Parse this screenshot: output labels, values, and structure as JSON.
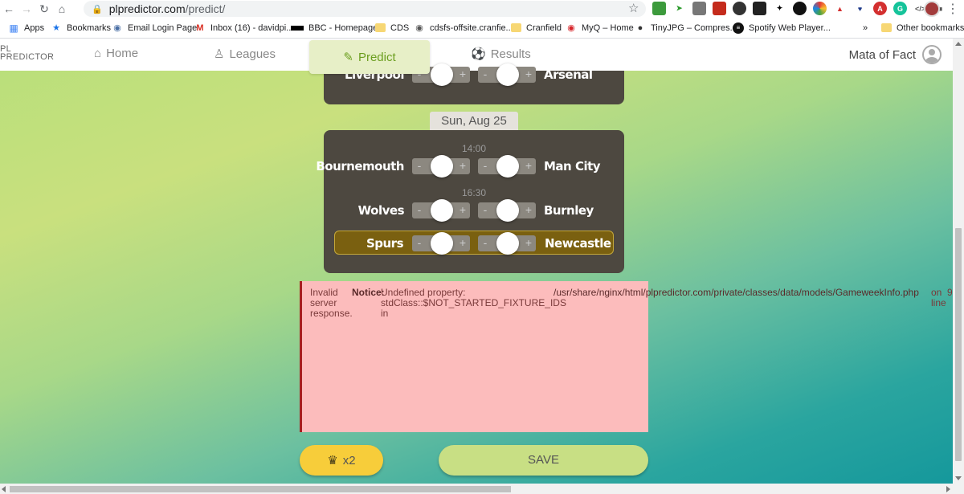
{
  "browser": {
    "url_host": "plpredictor.com",
    "url_path": "/predict/",
    "bookmarks": [
      {
        "label": "Apps",
        "icon": "apps-grid-icon"
      },
      {
        "label": "Bookmarks",
        "icon": "star-icon"
      },
      {
        "label": "Email Login Page",
        "icon": "globe-icon"
      },
      {
        "label": "Inbox (16) - davidpi...",
        "icon": "gmail-icon"
      },
      {
        "label": "BBC - Homepage",
        "icon": "bbc-icon"
      },
      {
        "label": "CDS",
        "icon": "folder-icon"
      },
      {
        "label": "cdsfs-offsite.cranfie...",
        "icon": "globe-icon"
      },
      {
        "label": "Cranfield",
        "icon": "folder-icon"
      },
      {
        "label": "MyQ – Home",
        "icon": "myq-icon"
      },
      {
        "label": "TinyJPG – Compres...",
        "icon": "panda-icon"
      },
      {
        "label": "Spotify Web Player...",
        "icon": "spotify-icon"
      }
    ],
    "more_bookmarks": "»",
    "other_bookmarks": "Other bookmarks"
  },
  "nav": {
    "logo_line1": "PL",
    "logo_line2": "PREDICTOR",
    "home": "Home",
    "leagues": "Leagues",
    "predict": "Predict",
    "results": "Results",
    "username": "Mata of Fact"
  },
  "previous_fixture": {
    "home": "Liverpool",
    "away": "Arsenal"
  },
  "date_label": "Sun, Aug 25",
  "time_slots": [
    "14:00",
    "16:30"
  ],
  "fixtures": [
    {
      "home": "Bournemouth",
      "away": "Man City"
    },
    {
      "home": "Wolves",
      "away": "Burnley"
    },
    {
      "home": "Spurs",
      "away": "Newcastle"
    }
  ],
  "stepper": {
    "minus": "-",
    "plus": "+"
  },
  "error": {
    "col1": "Invalid server response.",
    "col2": "Notice:",
    "col3": "Undefined property: stdClass::$NOT_STARTED_FIXTURE_IDS in",
    "col4": "/usr/share/nginx/html/plpredictor.com/private/classes/data/models/GameweekInfo.php",
    "col5": "on line",
    "col6": "9"
  },
  "buttons": {
    "double": "x2",
    "save": "SAVE"
  },
  "colors": {
    "accent": "#6b9e1f",
    "card": "#4d4840",
    "highlight": "#7a6010",
    "error_bg": "#fcbcbc",
    "double_btn": "#f7cd3a",
    "save_btn": "#c8df84"
  }
}
